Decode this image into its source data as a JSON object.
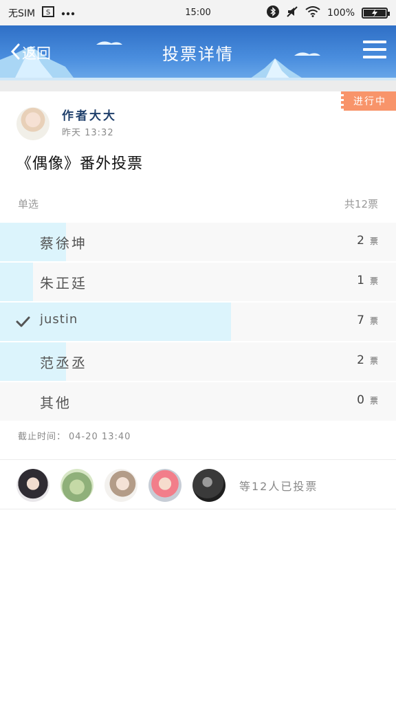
{
  "status_bar": {
    "carrier": "无SIM",
    "time": "15:00",
    "battery": "100%"
  },
  "header": {
    "back_label": "返回",
    "title": "投票详情"
  },
  "poll": {
    "status_badge": "进行中",
    "author_name": "作者大大",
    "author_time": "昨天 13:32",
    "title": "《偶像》番外投票",
    "mode": "单选",
    "total_votes": "共12票",
    "total": 12,
    "options": [
      {
        "label": "蔡徐坤",
        "count": "2",
        "unit": "票",
        "votes": 2,
        "selected": false
      },
      {
        "label": "朱正廷",
        "count": "1",
        "unit": "票",
        "votes": 1,
        "selected": false
      },
      {
        "label": "justin",
        "count": "7",
        "unit": "票",
        "votes": 7,
        "selected": true
      },
      {
        "label": "范丞丞",
        "count": "2",
        "unit": "票",
        "votes": 2,
        "selected": false
      },
      {
        "label": "其他",
        "count": "0",
        "unit": "票",
        "votes": 0,
        "selected": false
      }
    ],
    "deadline_label": "截止时间：",
    "deadline_value": "04-20 13:40",
    "voters_summary": "等12人已投票"
  },
  "colors": {
    "header_blue": "#3f82d6",
    "badge_orange": "#f8946a",
    "vote_fill": "#dcf4fc"
  }
}
